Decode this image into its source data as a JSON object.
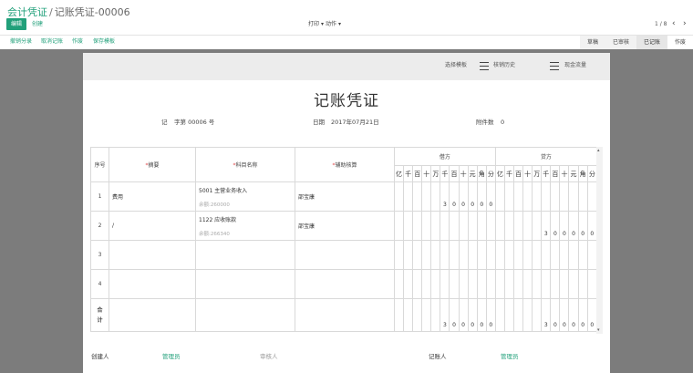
{
  "breadcrumb": {
    "parent": "会计凭证",
    "separator": "/",
    "current": "记账凭证-00006"
  },
  "toolbar": {
    "edit": "编辑",
    "create": "创建",
    "print": "打印",
    "action": "动作",
    "pager": "1 / 8",
    "prev": "‹",
    "next": "›"
  },
  "statusbar": {
    "links": [
      "撤销分录",
      "取消记账",
      "作废",
      "保存模板"
    ],
    "steps": [
      "草稿",
      "已审核",
      "已记账",
      "作废"
    ],
    "active_step": "已记账"
  },
  "sheet_toolbar": {
    "template": "选择模板",
    "history": "核销历史",
    "cashflow": "现金流量"
  },
  "voucher": {
    "title": "记账凭证",
    "type_label": "记",
    "number_label": "字第 00006 号",
    "date_label": "日期",
    "date_value": "2017年07月21日",
    "attach_label": "附件数",
    "attach_value": "0"
  },
  "table": {
    "headers": {
      "no": "序号",
      "summary": "摘要",
      "account": "科目名称",
      "aux": "辅助核算",
      "debit": "借方",
      "credit": "贷方"
    },
    "digits": [
      "亿",
      "千",
      "百",
      "十",
      "万",
      "千",
      "百",
      "十",
      "元",
      "角",
      "分"
    ],
    "rows": [
      {
        "no": "1",
        "summary": "费用",
        "account": "5001 主营业务收入",
        "balance": "余额:260000",
        "aux": "邵宝康",
        "debit": "300000",
        "credit": ""
      },
      {
        "no": "2",
        "summary": "/",
        "account": "1122 应收账款",
        "balance": "余额:266340",
        "aux": "邵宝康",
        "debit": "",
        "credit": "300000"
      },
      {
        "no": "3",
        "summary": "",
        "account": "",
        "balance": "",
        "aux": "",
        "debit": "",
        "credit": ""
      },
      {
        "no": "4",
        "summary": "",
        "account": "",
        "balance": "",
        "aux": "",
        "debit": "",
        "credit": ""
      }
    ],
    "total_label_1": "合",
    "total_label_2": "计",
    "total_debit": "300000",
    "total_credit": "300000"
  },
  "footer": {
    "creator_label": "创建人",
    "creator": "管理员",
    "auditor_label": "审核人",
    "poster_label": "记账人",
    "poster": "管理员"
  },
  "colors": {
    "accent": "#21a07a",
    "required": "#e0484a",
    "gray_bg": "#7c7c7c"
  }
}
